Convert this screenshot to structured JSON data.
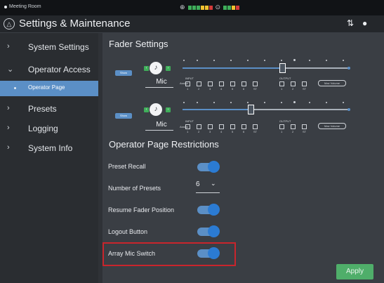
{
  "topbar": {
    "room_name": "Meeting Room",
    "colors": {
      "green": "#3fae5a",
      "yellow": "#f2c230",
      "red": "#d33a3a"
    }
  },
  "header": {
    "title": "Settings & Maintenance",
    "icons": [
      "audio-logo-icon",
      "equalizer-icon",
      "user-icon"
    ]
  },
  "sidebar": {
    "items": [
      {
        "label": "System Settings",
        "chevron": "›"
      },
      {
        "label": "Operator Access",
        "chevron": "⌄"
      },
      {
        "label": "Presets",
        "chevron": "›"
      },
      {
        "label": "Logging",
        "chevron": "›"
      },
      {
        "label": "System Info",
        "chevron": "›"
      }
    ],
    "sub_item": {
      "label": "Operator Page"
    }
  },
  "fader_settings": {
    "title": "Fader Settings",
    "rows": [
      {
        "view_label": "Show",
        "mic_label": "Mic",
        "assign_label": "Assign",
        "input_label": "INPUT",
        "output_label": "OUTPUT",
        "input_channels": [
          "1",
          "2",
          "3",
          "4",
          "5",
          "6",
          "ST"
        ],
        "output_channels": [
          "1",
          "2",
          "ST"
        ],
        "max_volume_label": "Max Volume",
        "fader_level": 0.6
      },
      {
        "view_label": "Show",
        "mic_label": "Mic",
        "assign_label": "Assign",
        "input_label": "INPUT",
        "output_label": "OUTPUT",
        "input_channels": [
          "1",
          "2",
          "3",
          "4",
          "5",
          "6",
          "ST"
        ],
        "output_channels": [
          "1",
          "2",
          "ST"
        ],
        "max_volume_label": "Max Volume",
        "fader_level": 0.41
      }
    ]
  },
  "restrictions": {
    "title": "Operator Page Restrictions",
    "preset_recall": {
      "label": "Preset Recall",
      "on": true
    },
    "number_of_presets": {
      "label": "Number of Presets",
      "value": "6"
    },
    "resume_fader_position": {
      "label": "Resume Fader Position",
      "on": true
    },
    "logout_button": {
      "label": "Logout Button",
      "on": true
    },
    "array_mic_switch": {
      "label": "Array Mic Switch",
      "on": true
    }
  },
  "apply_label": "Apply"
}
